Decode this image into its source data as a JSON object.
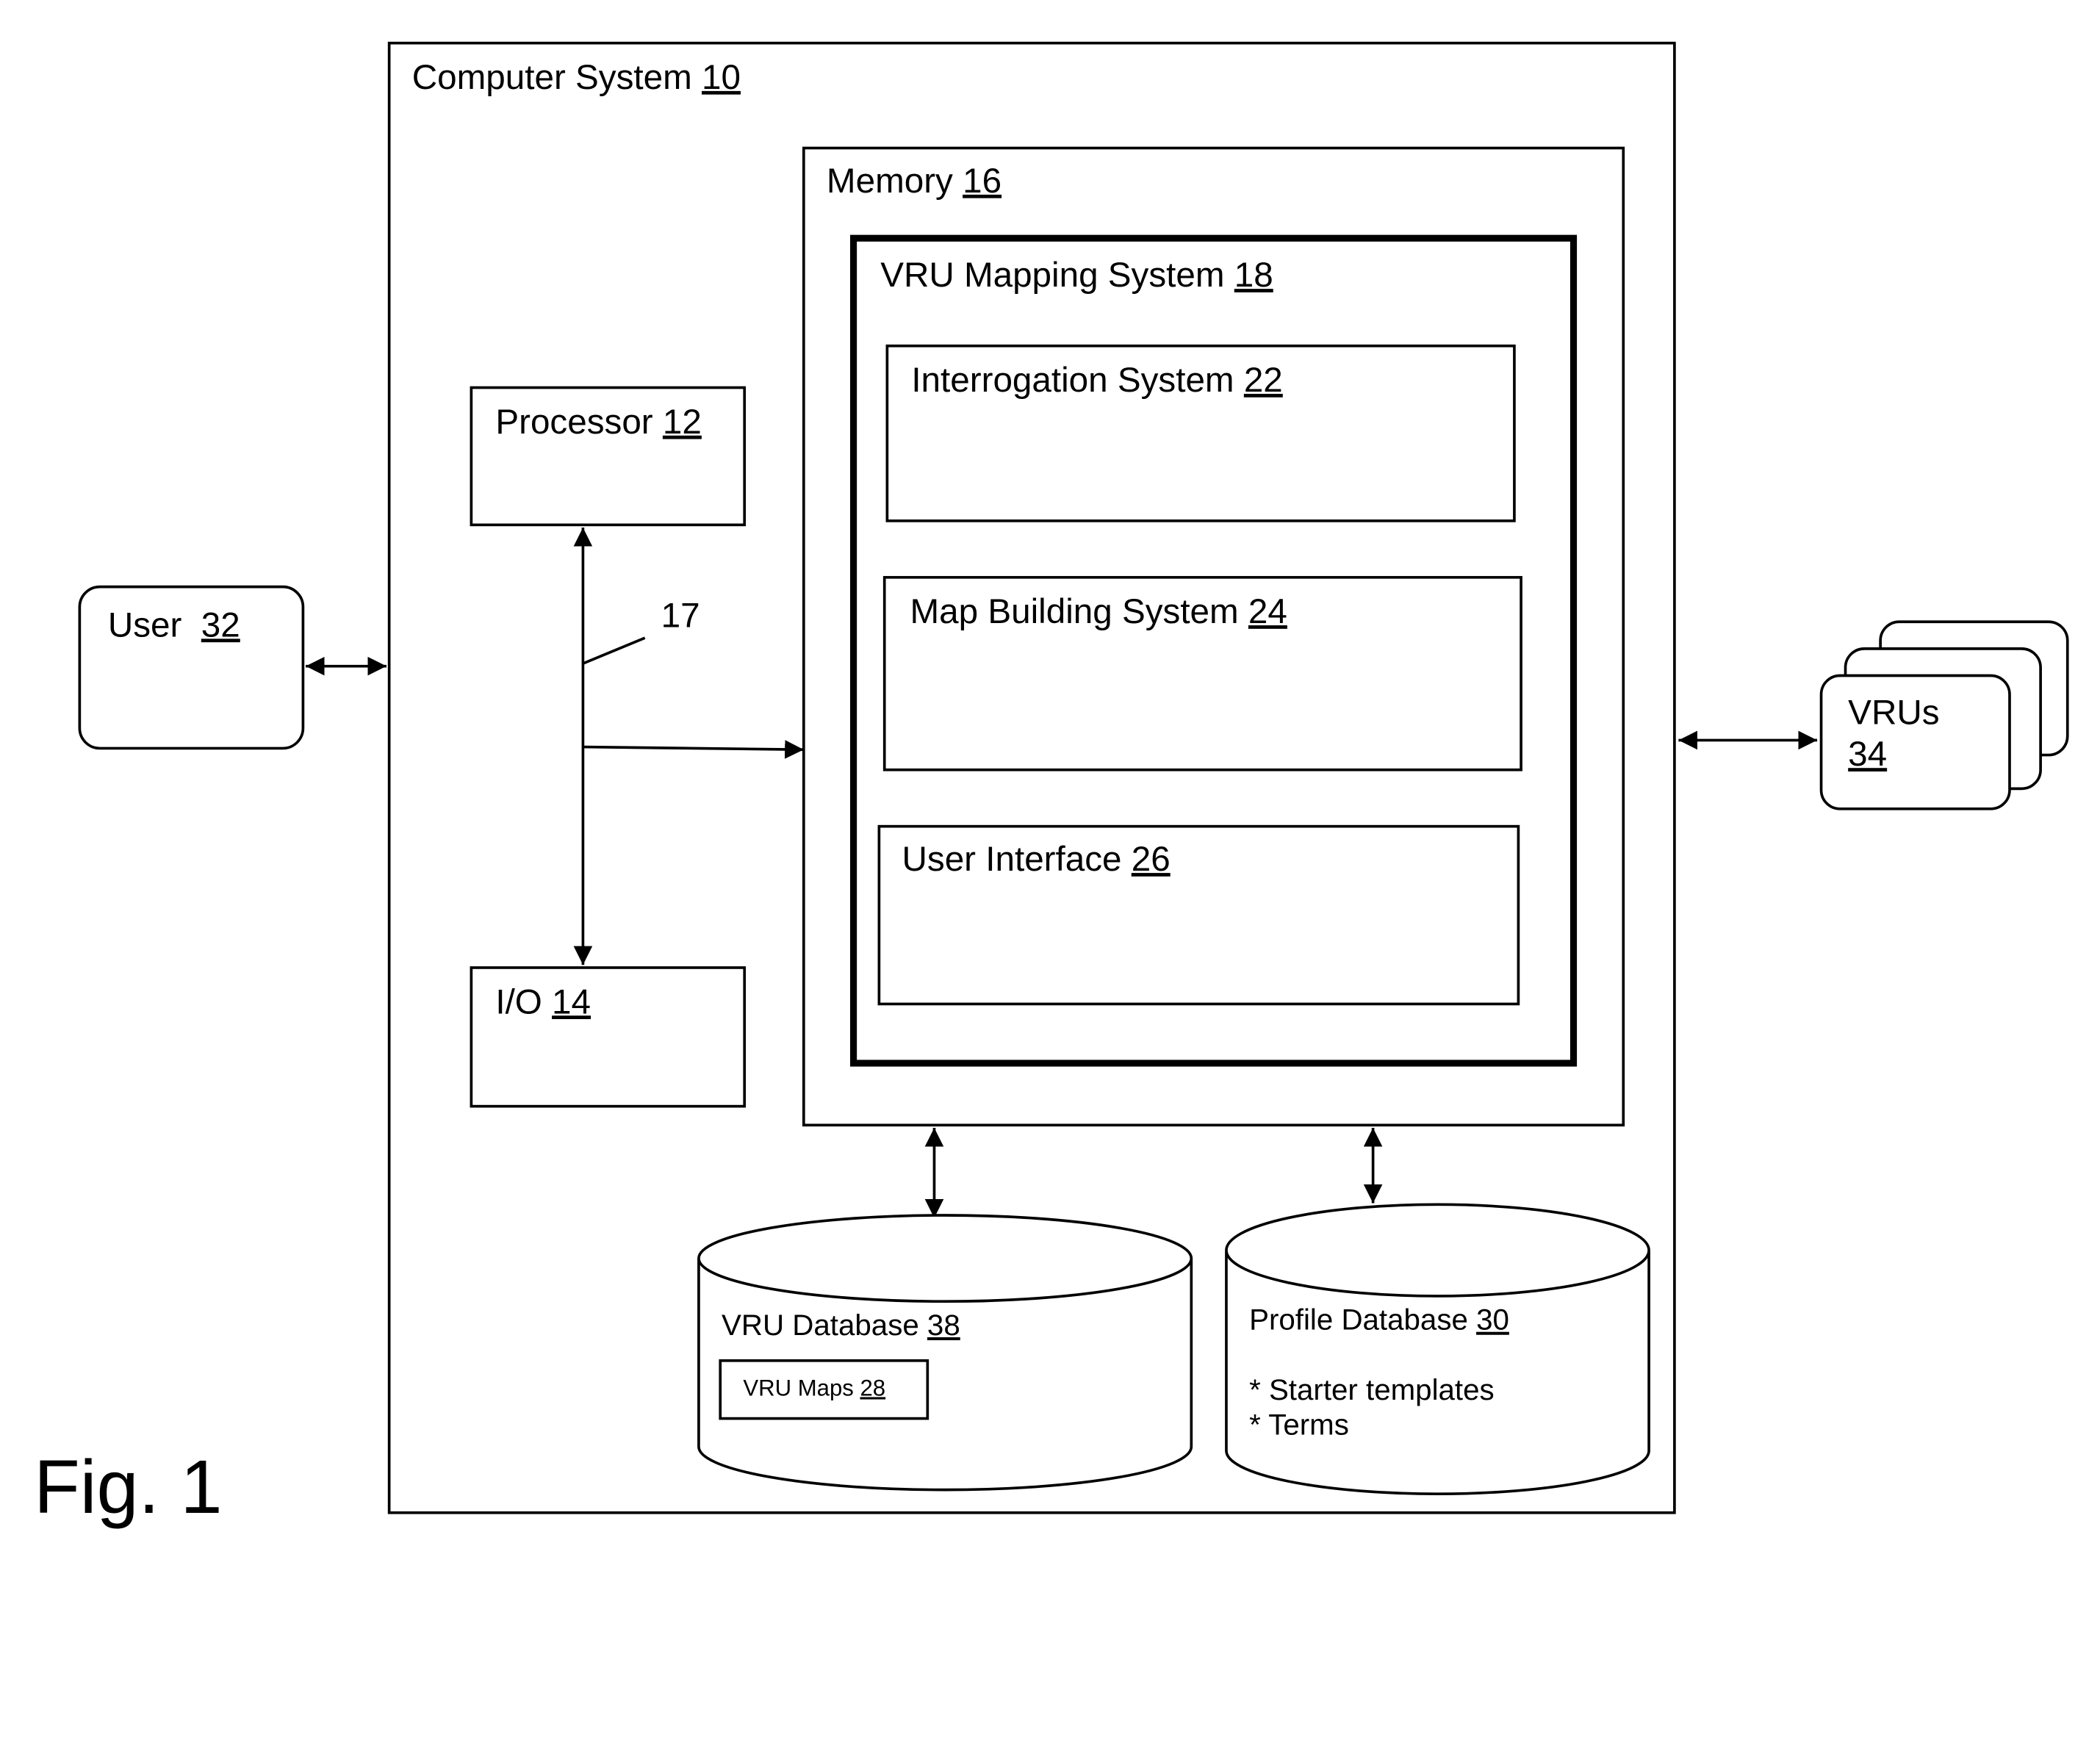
{
  "figure": {
    "caption": "Fig. 1",
    "colors": {
      "ink": "#000000",
      "background": "#ffffff"
    }
  },
  "computer_system": {
    "label": "Computer System ",
    "ref": "10"
  },
  "memory": {
    "label": "Memory ",
    "ref": "16"
  },
  "vru_mapping_system": {
    "label": "VRU Mapping System ",
    "ref": "18"
  },
  "interrogation_system": {
    "label": "Interrogation System ",
    "ref": "22"
  },
  "map_building_system": {
    "label": "Map Building System ",
    "ref": "24"
  },
  "user_interface": {
    "label": "User Interface ",
    "ref": "26"
  },
  "processor": {
    "label": "Processor ",
    "ref": "12"
  },
  "io": {
    "label": "I/O ",
    "ref": "14"
  },
  "bus": {
    "ref": "17"
  },
  "user": {
    "label": "User  ",
    "ref": "32"
  },
  "vrus": {
    "label": "VRUs",
    "ref": "34"
  },
  "vru_database": {
    "label": "VRU Database ",
    "ref": "38",
    "vru_maps": {
      "label": "VRU Maps ",
      "ref": "28"
    }
  },
  "profile_database": {
    "label": "Profile Database ",
    "ref": "30",
    "items": [
      "* Starter templates",
      "* Terms"
    ]
  }
}
